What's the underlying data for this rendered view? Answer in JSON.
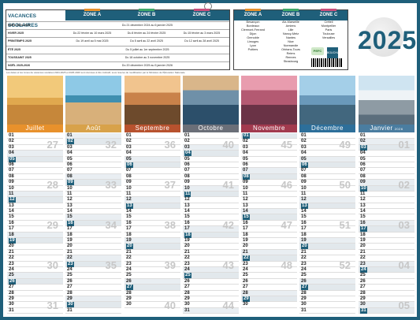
{
  "calendar": {
    "year": "2025",
    "vacations_title": "VACANCES SCOLAIRES",
    "zones": [
      "ZONE A",
      "ZONE B",
      "ZONE C"
    ],
    "zone_colors": [
      "#e8912c",
      "#3fa86a",
      "#c94f7c"
    ],
    "vacation_rows": [
      {
        "label": "NOËL 2024-2025",
        "cells": [
          "Du 21 décembre 2024 au 6 janvier 2025",
          "",
          ""
        ]
      },
      {
        "label": "HIVER 2025",
        "cells": [
          "Du 22 février au 10 mars 2025",
          "Du 8 février au 24 février 2025",
          "Du 15 février au 3 mars 2025"
        ]
      },
      {
        "label": "PRINTEMPS 2025",
        "cells": [
          "Du 19 avril au 5 mai 2025",
          "Du 5 avril au 22 avril 2025",
          "Du 12 avril au 28 avril 2025"
        ]
      },
      {
        "label": "ÉTÉ 2025",
        "cells": [
          "Du 5 juillet au 1er septembre 2025",
          "",
          ""
        ]
      },
      {
        "label": "TOUSSAINT 2025",
        "cells": [
          "Du 18 octobre au 3 novembre 2025",
          "",
          ""
        ]
      },
      {
        "label": "NOËL 2025-2026",
        "cells": [
          "Du 20 décembre 2025 au 5 janvier 2026",
          "",
          ""
        ]
      }
    ],
    "zone_cities": [
      [
        "Besançon",
        "Bordeaux",
        "Clermont-Ferrand",
        "Dijon",
        "Grenoble",
        "Limoges",
        "Lyon",
        "Poitiers"
      ],
      [
        "Aix-Marseille",
        "Amiens",
        "Lille",
        "Nancy-Metz",
        "Nantes",
        "Nice",
        "Normandie",
        "Orléans-Tours",
        "Reims",
        "Rennes",
        "Strasbourg"
      ],
      [
        "Créteil",
        "Montpellier",
        "Paris",
        "Toulouse",
        "Versailles"
      ]
    ],
    "logo_texts": [
      "PEFC",
      "BOUCHUT"
    ],
    "note": "Les dates et les zones de vacances scolaires 2024-2025 et 2025-2026 sont données à titre indicatif, sous réserve de modification par le Ministère de l'Éducation Nationale.",
    "months": [
      {
        "name": "Juillet",
        "color": "#e8912c",
        "photo": "desert",
        "weeks": [
          "27",
          "28",
          "29",
          "30",
          "31"
        ]
      },
      {
        "name": "Août",
        "color": "#d8a24a",
        "photo": "seaarch",
        "weeks": [
          "32",
          "33",
          "34",
          "35"
        ]
      },
      {
        "name": "Septembre",
        "color": "#b8522e",
        "photo": "bagan",
        "weeks": [
          "36",
          "37",
          "38",
          "39",
          "40"
        ]
      },
      {
        "name": "Octobre",
        "color": "#6b6f78",
        "photo": "lake",
        "weeks": [
          "40",
          "41",
          "42",
          "43",
          "44"
        ]
      },
      {
        "name": "Novembre",
        "color": "#a23a4e",
        "photo": "canyon",
        "weeks": [
          "45",
          "46",
          "47",
          "48"
        ]
      },
      {
        "name": "Décembre",
        "color": "#2d6f9a",
        "photo": "coast",
        "weeks": [
          "49",
          "50",
          "51",
          "52"
        ]
      },
      {
        "name": "Janvier",
        "year_suffix": "2026",
        "color": "#4a7da0",
        "photo": "mountain",
        "weeks": [
          "01",
          "02",
          "03",
          "04",
          "05"
        ]
      }
    ]
  }
}
